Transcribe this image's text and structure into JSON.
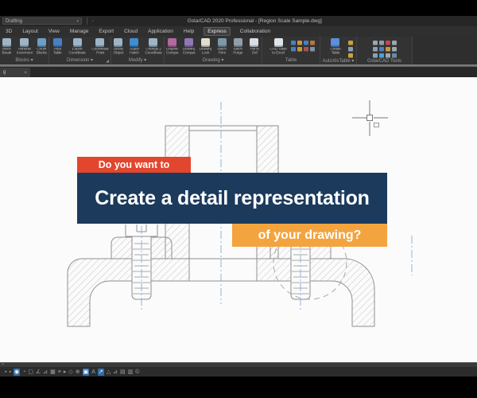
{
  "theme": {
    "canvas-bg": "#fbfbfb",
    "line-gray": "#8f8f8f",
    "hatch-gray": "#b9b9b9",
    "centerline-blue": "#8cb4e2",
    "banner-red": "#e2462e",
    "banner-navy": "#1b3a5c",
    "banner-orange": "#f3a43e"
  },
  "titlebar": {
    "workspace": "Drafting",
    "workspace_arrow": "▾",
    "title": "GstarCAD 2020 Professional - [Region Scale Sample.dwg]"
  },
  "menu": {
    "items": [
      "3D",
      "Layout",
      "View",
      "Manage",
      "Export",
      "Cloud",
      "Application",
      "Help",
      "Express",
      "Collaboration"
    ]
  },
  "ribbon": {
    "groups": [
      {
        "label": "Blocks ▾",
        "buttons": [
          {
            "label": "Block Break",
            "color": "#9db5c6"
          },
          {
            "label": "Attribute Increment",
            "color": "#9db5c6"
          },
          {
            "label": "Count Blocks",
            "color": "#6d9ec7"
          }
        ]
      },
      {
        "label": "Dimension ▾",
        "buttons": [
          {
            "label": "Area Table",
            "color": "#4a80c0"
          },
          {
            "label": "Export Coordinate",
            "color": "#9db5c6"
          },
          {
            "label": "Coordinate Point",
            "color": "#9db5c6"
          }
        ]
      },
      {
        "label": "Modify ▾",
        "buttons": [
          {
            "label": "Break Object",
            "color": "#9db5c6"
          },
          {
            "label": "Super Hatch",
            "color": "#3e8ed2"
          },
          {
            "label": "Change Z Coordinate",
            "color": "#9db5c6"
          }
        ]
      },
      {
        "label": "Drawing ▾",
        "buttons": [
          {
            "label": "Graphic Compare",
            "color": "#b06a9e"
          },
          {
            "label": "Drawing Compare",
            "color": "#8f77b8"
          },
          {
            "label": "Drawing Lock",
            "color": "#e3ddcf"
          },
          {
            "label": "Batch Print",
            "color": "#7f98a8"
          },
          {
            "label": "Batch Purge",
            "color": "#90a0aa"
          },
          {
            "label": "Pdf to Dxf",
            "color": "#d8dde4"
          }
        ]
      },
      {
        "label": "Table",
        "buttons": [
          {
            "label": "CAD Table to Excel",
            "color": "#dfe5ea"
          }
        ]
      },
      {
        "label": "AutoXlsTable ▾",
        "buttons": [
          {
            "label": "Create Table",
            "color": "#5b8fd6"
          }
        ]
      },
      {
        "label": "GstarCAD Tools",
        "buttons": []
      }
    ],
    "table_grid": [
      "#4d7fbe",
      "#c9973e",
      "#4d7fbe",
      "#b8743e",
      "#4d7fbe",
      "#c9973e",
      "#a85454",
      "#7d94a6"
    ],
    "autoxls_grid": [
      "#c9a23e",
      "#8aa0b4",
      "#c9a23e"
    ],
    "gstar_grid": [
      "#9aa7b2",
      "#8aa0b4",
      "#bf4a4a",
      "#9aa7b2",
      "#8aa0b4",
      "#4d7fbe",
      "#c9973e",
      "#9aa7b2",
      "#8aa0b4",
      "#4da0d0",
      "#9aa7b2",
      "#6a8aa8"
    ]
  },
  "doc_tab": {
    "visible_label": "g",
    "close": "×"
  },
  "overlay": {
    "kicker": "Do you want to",
    "headline": "Create a detail representation",
    "footer": "of your drawing?"
  },
  "command_line": {
    "prompt": ">"
  },
  "status_bar": {
    "icons": [
      "▪",
      "▪",
      "◉",
      "◔",
      "▢",
      "∠",
      "⊿",
      "▦",
      "≡",
      "▸",
      "◇",
      "⊕",
      "▣",
      "A",
      "↗",
      "△",
      "⊿",
      "▤",
      "▥",
      "©"
    ],
    "active_indices": [
      2,
      12,
      14
    ]
  }
}
